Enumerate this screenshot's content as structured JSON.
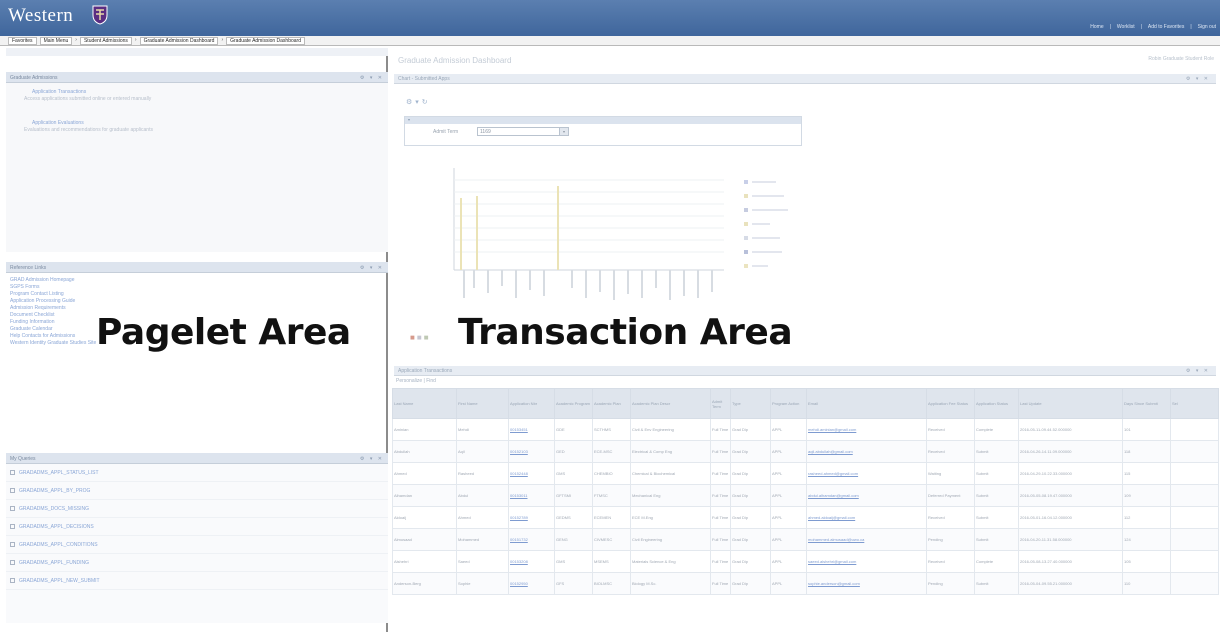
{
  "header": {
    "logo_text": "Western",
    "links": [
      "Home",
      "Worklist",
      "Add to Favorites",
      "Sign out"
    ]
  },
  "breadcrumb": [
    "Favorites",
    "Main Menu",
    "Student Admissions",
    "Graduate Admission Dashboard",
    "Graduate Admission Dashboard"
  ],
  "pagelets": {
    "first": {
      "title": "Graduate Admissions",
      "items": [
        {
          "link": "Application Transactions",
          "desc": "Access applications submitted online or entered manually"
        },
        {
          "link": "Application Evaluations",
          "desc": "Evaluations and recommendations for graduate applicants"
        }
      ]
    },
    "second": {
      "title": "Reference Links",
      "links": [
        "GRAD Admission Homepage",
        "SGPS Forms",
        "Program Contact Listing",
        "Application Processing Guide",
        "Admission Requirements",
        "Document Checklist",
        "Funding Information",
        "Graduate Calendar",
        "Help Contacts for Admissions",
        "Western Identity Graduate Studies Site"
      ]
    },
    "third": {
      "title": "My Queries",
      "items": [
        "GRADADMS_APPL_STATUS_LIST",
        "GRADADMS_APPL_BY_PROG",
        "GRADADMS_DOCS_MISSING",
        "GRADADMS_APPL_DECISIONS",
        "GRADADMS_APPL_CONDITIONS",
        "GRADADMS_APPL_FUNDING",
        "GRADADMS_APPL_NEW_SUBMIT"
      ]
    }
  },
  "transaction": {
    "title": "Graduate Admission Dashboard",
    "user_info": "Robin Graduate Student Role",
    "chart_section_title": "Chart - Submitted Apps",
    "filter": {
      "label": "Admit Term",
      "value": "1169"
    },
    "table_section_title": "Application Transactions",
    "table_subtitle": "Personalize | Find",
    "table_headers": [
      "Last Name",
      "First Name",
      "Application Nbr",
      "Academic Program",
      "Academic Plan",
      "Academic Plan Descr",
      "Admit Term",
      "Type",
      "Program Action",
      "Email",
      "Application Fee Status",
      "Application Status",
      "Last Update",
      "Days Since Submit",
      "Sel"
    ],
    "rows": [
      [
        "Aminian",
        "Mehdi",
        "00153451",
        "GDE",
        "SCTHMS",
        "Civil & Env Engineering",
        "Full Time",
        "Grad Dip",
        "APPL",
        "mehdi.aminian@gmail.com",
        "Received",
        "Complete",
        "2016-05-11-09.44.52.000000",
        "101",
        ""
      ],
      [
        "Abdullah",
        "Aqil",
        "00152103",
        "GED",
        "ECE-MSC",
        "Electrical & Comp Eng",
        "Full Time",
        "Grad Dip",
        "APPL",
        "aqil.abdullah@gmail.com",
        "Received",
        "Submit",
        "2016-04-26-14.11.09.000000",
        "118",
        ""
      ],
      [
        "Ahmed",
        "Rasheed",
        "00152448",
        "GMS",
        "CHEMBIO",
        "Chemical & Biochemical",
        "Full Time",
        "Grad Dip",
        "APPL",
        "rasheed.ahmed@gmail.com",
        "Waiting",
        "Submit",
        "2016-04-29-10.22.33.000000",
        "115",
        ""
      ],
      [
        "Alhamdan",
        "Abdul",
        "00153011",
        "GFTSMI",
        "FTMSC",
        "Mechanical Eng",
        "Full Time",
        "Grad Dip",
        "APPL",
        "abdul.alhamdan@gmail.com",
        "Deferred Payment",
        "Submit",
        "2016-05-05-08.19.47.000000",
        "109",
        ""
      ],
      [
        "Aldoaij",
        "Ahmed",
        "00152789",
        "GEDMS",
        "ECEMEN",
        "ECE M.Eng",
        "Full Time",
        "Grad Dip",
        "APPL",
        "ahmed.aldoaij@gmail.com",
        "Received",
        "Submit",
        "2016-05-01-16.04.12.000000",
        "112",
        ""
      ],
      [
        "Almusaad",
        "Mohammed",
        "00151732",
        "GENG",
        "CIVMESC",
        "Civil Engineering",
        "Full Time",
        "Grad Dip",
        "APPL",
        "mohammed.almusaad@uwo.ca",
        "Pending",
        "Submit",
        "2016-04-20-11.31.58.000000",
        "124",
        ""
      ],
      [
        "Alshehri",
        "Saeed",
        "00153208",
        "GMS",
        "MSEMS",
        "Materials Science & Eng",
        "Full Time",
        "Grad Dip",
        "APPL",
        "saeed.alshehri@gmail.com",
        "Received",
        "Complete",
        "2016-05-08-13.27.40.000000",
        "105",
        ""
      ],
      [
        "Anderson-Berg",
        "Sophie",
        "00152950",
        "GFS",
        "BIOLMSC",
        "Biology M.Sc.",
        "Full Time",
        "Grad Dip",
        "APPL",
        "sophie.anderson@gmail.com",
        "Pending",
        "Submit",
        "2016-05-04-09.55.21.000000",
        "110",
        ""
      ]
    ]
  },
  "overlay_labels": {
    "pagelet": "Pagelet Area",
    "transaction": "Transaction Area"
  },
  "colors": {
    "header_blue": "#4a6fa5",
    "link_blue": "#8aa6d6",
    "chart_lines": "#e5dcae"
  }
}
